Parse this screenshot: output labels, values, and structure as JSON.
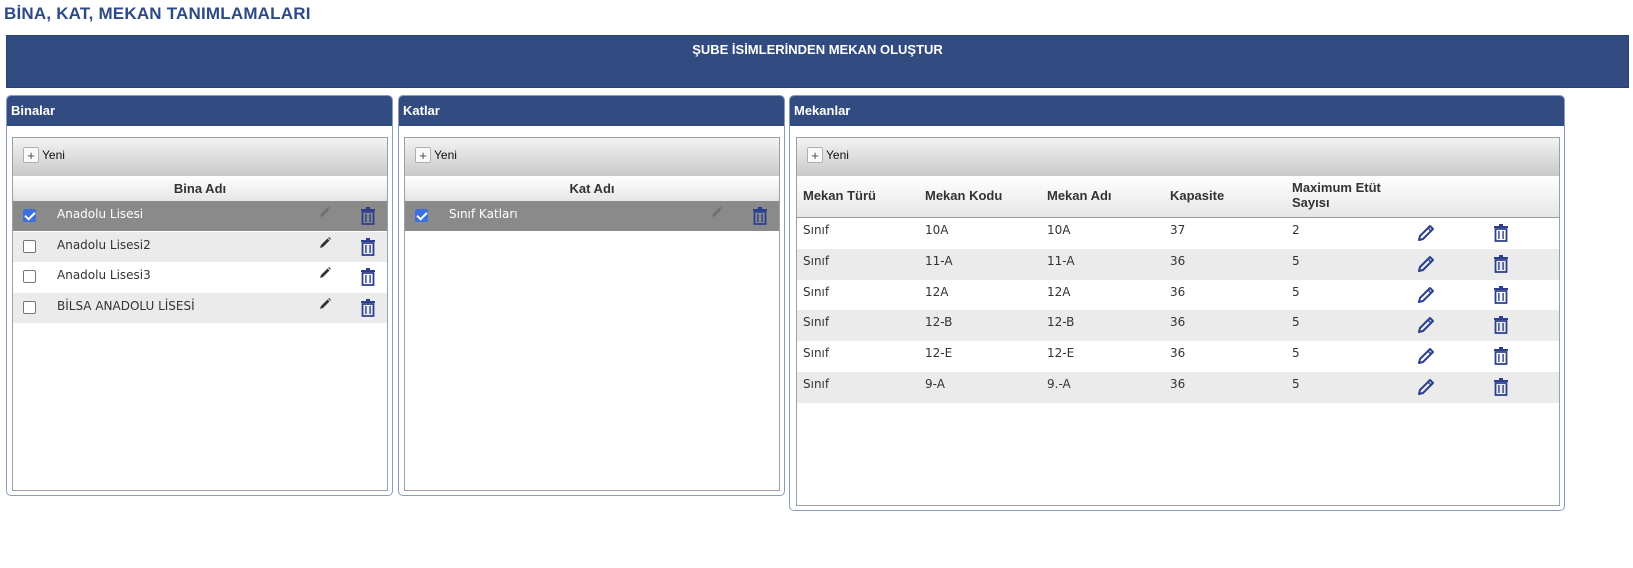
{
  "page": {
    "title": "BİNA, KAT, MEKAN TANIMLAMALARI"
  },
  "banner": {
    "action_label": "ŞUBE İSİMLERİNDEN MEKAN OLUŞTUR"
  },
  "colors": {
    "header_blue": "#324b80",
    "title_blue": "#2e4a86",
    "icon_blue": "#2c3f8e",
    "selected_row": "#8a8a8a"
  },
  "buildings": {
    "title": "Binalar",
    "new_label": "Yeni",
    "column": "Bina Adı",
    "rows": [
      {
        "name": "Anadolu Lisesi",
        "checked": true
      },
      {
        "name": "Anadolu Lisesi2",
        "checked": false
      },
      {
        "name": "Anadolu Lisesi3",
        "checked": false
      },
      {
        "name": "BİLSA ANADOLU LİSESİ",
        "checked": false
      }
    ]
  },
  "floors": {
    "title": "Katlar",
    "new_label": "Yeni",
    "column": "Kat Adı",
    "rows": [
      {
        "name": "Sınıf Katları",
        "checked": true
      }
    ]
  },
  "spaces": {
    "title": "Mekanlar",
    "new_label": "Yeni",
    "columns": [
      "Mekan Türü",
      "Mekan Kodu",
      "Mekan Adı",
      "Kapasite",
      "Maximum Etüt Sayısı"
    ],
    "rows": [
      [
        "Sınıf",
        "10A",
        "10A",
        "37",
        "2"
      ],
      [
        "Sınıf",
        "11-A",
        "11-A",
        "36",
        "5"
      ],
      [
        "Sınıf",
        "12A",
        "12A",
        "36",
        "5"
      ],
      [
        "Sınıf",
        "12-B",
        "12-B",
        "36",
        "5"
      ],
      [
        "Sınıf",
        "12-E",
        "12-E",
        "36",
        "5"
      ],
      [
        "Sınıf",
        "9-A",
        "9.-A",
        "36",
        "5"
      ]
    ]
  }
}
